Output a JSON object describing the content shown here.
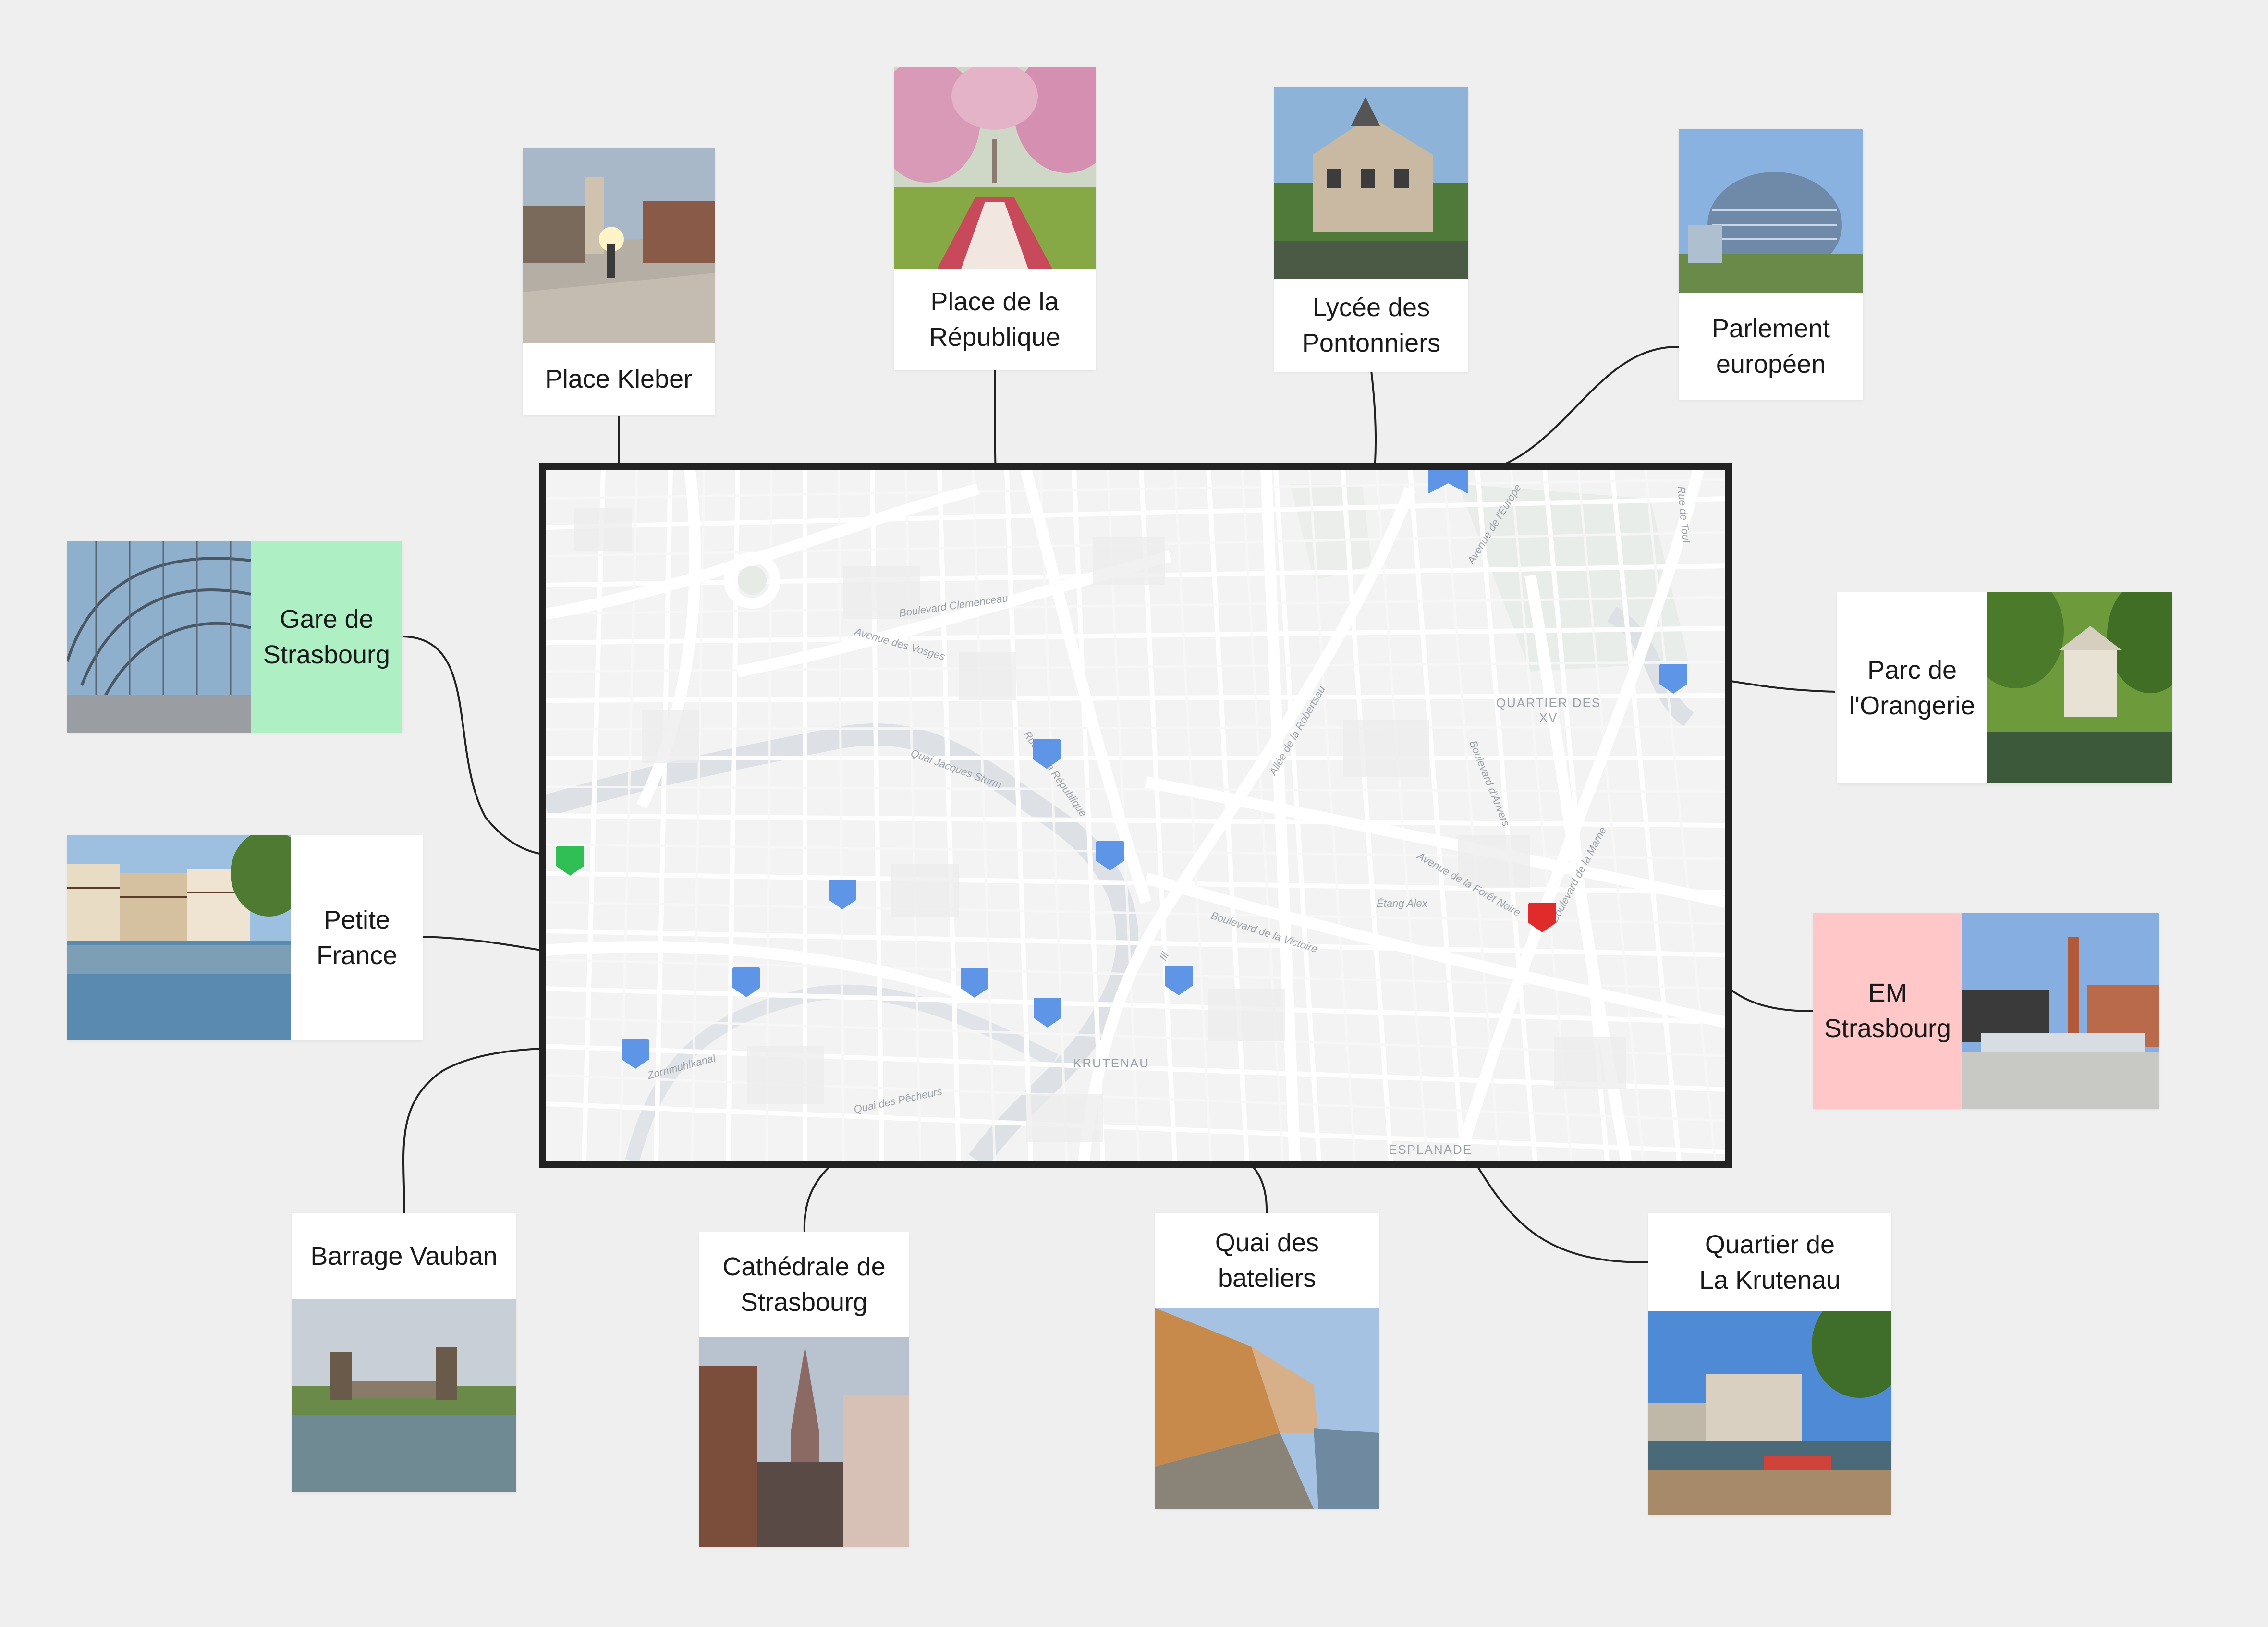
{
  "map": {
    "district_labels": {
      "quartier_des_xv_line1": "QUARTIER DES",
      "quartier_des_xv_line2": "XV",
      "krutenau": "KRUTENAU",
      "esplanade": "ESPLANADE"
    },
    "street_labels": {
      "boulevard_clemenceau": "Boulevard Clemenceau",
      "avenue_des_vosges": "Avenue des Vosges",
      "quai_jacques_sturm": "Quai Jacques Sturm",
      "rue_de_la_republique": "Rue de la République",
      "allee_de_la_robertsau": "Allée de la Robertsau",
      "boulevard_d_anvers": "Boulevard d'Anvers",
      "avenue_de_la_foret_noire": "Avenue de la Forêt Noire",
      "boulevard_de_la_victoire": "Boulevard de la Victoire",
      "etang_alex": "Étang Alex",
      "avenue_de_l_europe": "Avenue de l'Europe",
      "boulevard_de_la_marne": "Boulevard de la Marne",
      "zorn_muhlkanal": "Zornmuhlkanal",
      "ill": "Ill",
      "rue_de_toul": "Rue de Toul",
      "quai_des_pecheurs": "Quai des Pêcheurs"
    }
  },
  "places": {
    "place_kleber": {
      "name": "Place Kleber"
    },
    "place_republique": {
      "name_line1": "Place de la",
      "name_line2": "République"
    },
    "lycee_pontonniers": {
      "name_line1": "Lycée des",
      "name_line2": "Pontonniers"
    },
    "parlement_europeen": {
      "name_line1": "Parlement",
      "name_line2": "européen"
    },
    "gare_strasbourg": {
      "name_line1": "Gare de",
      "name_line2": "Strasbourg"
    },
    "parc_orangerie": {
      "name_line1": "Parc de",
      "name_line2": "l'Orangerie"
    },
    "petite_france": {
      "name_line1": "Petite",
      "name_line2": "France"
    },
    "em_strasbourg": {
      "name_line1": "EM",
      "name_line2": "Strasbourg"
    },
    "barrage_vauban": {
      "name": "Barrage Vauban"
    },
    "cathedrale": {
      "name_line1": "Cathédrale de",
      "name_line2": "Strasbourg"
    },
    "quai_bateliers": {
      "name_line1": "Quai des",
      "name_line2": "bateliers"
    },
    "quartier_krutenau": {
      "name_line1": "Quartier de",
      "name_line2": "La Krutenau"
    }
  },
  "colors": {
    "marker_default": "#5f95e6",
    "marker_gare": "#2fbf55",
    "marker_em": "#e02b2b",
    "label_gare_bg": "#aef0c4",
    "label_em_bg": "#ffc7c7",
    "connector": "#222222"
  }
}
